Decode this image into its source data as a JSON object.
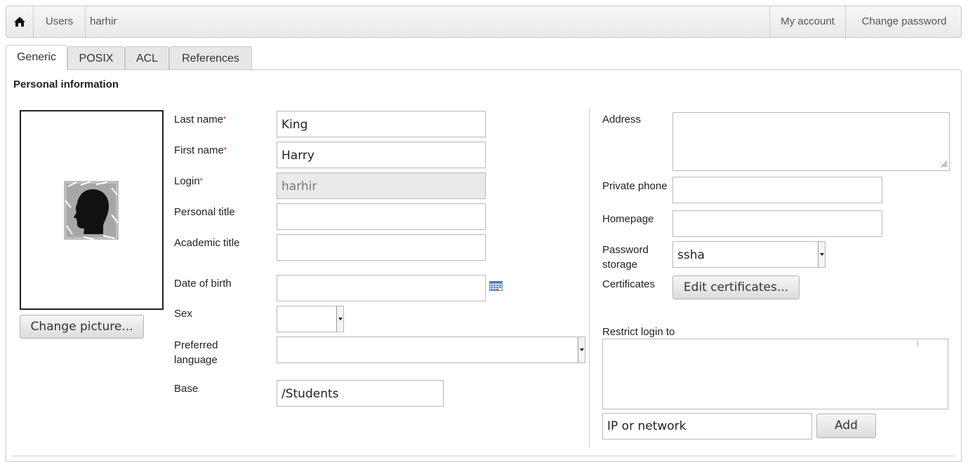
{
  "nav": {
    "home_icon": "home-icon",
    "users": "Users",
    "current": "harhir",
    "my_account": "My account",
    "change_password": "Change password"
  },
  "tabs": [
    "Generic",
    "POSIX",
    "ACL",
    "References"
  ],
  "section_title": "Personal information",
  "photo": {
    "icon": "head-silhouette-icon",
    "change_button": "Change picture..."
  },
  "form": {
    "last_name": {
      "label": "Last name",
      "required": "*",
      "value": "King"
    },
    "first_name": {
      "label": "First name",
      "required": "*",
      "value": "Harry"
    },
    "login": {
      "label": "Login",
      "required": "*",
      "value": "harhir"
    },
    "personal_title": {
      "label": "Personal title",
      "value": ""
    },
    "academic_title": {
      "label": "Academic title",
      "value": ""
    },
    "date_of_birth": {
      "label": "Date of birth",
      "value": "",
      "icon": "calendar-icon"
    },
    "sex": {
      "label": "Sex",
      "value": ""
    },
    "preferred_language": {
      "label": "Preferred language",
      "value": ""
    },
    "base": {
      "label": "Base",
      "value": "/Students"
    }
  },
  "right": {
    "address": {
      "label": "Address",
      "value": ""
    },
    "private_phone": {
      "label": "Private phone",
      "value": ""
    },
    "homepage": {
      "label": "Homepage",
      "value": ""
    },
    "password_storage": {
      "label": "Password storage",
      "value": "ssha"
    },
    "certificates": {
      "label": "Certificates",
      "button": "Edit certificates..."
    },
    "restrict_login": {
      "label": "Restrict login to",
      "placeholder": "IP or network",
      "add_button": "Add"
    }
  }
}
